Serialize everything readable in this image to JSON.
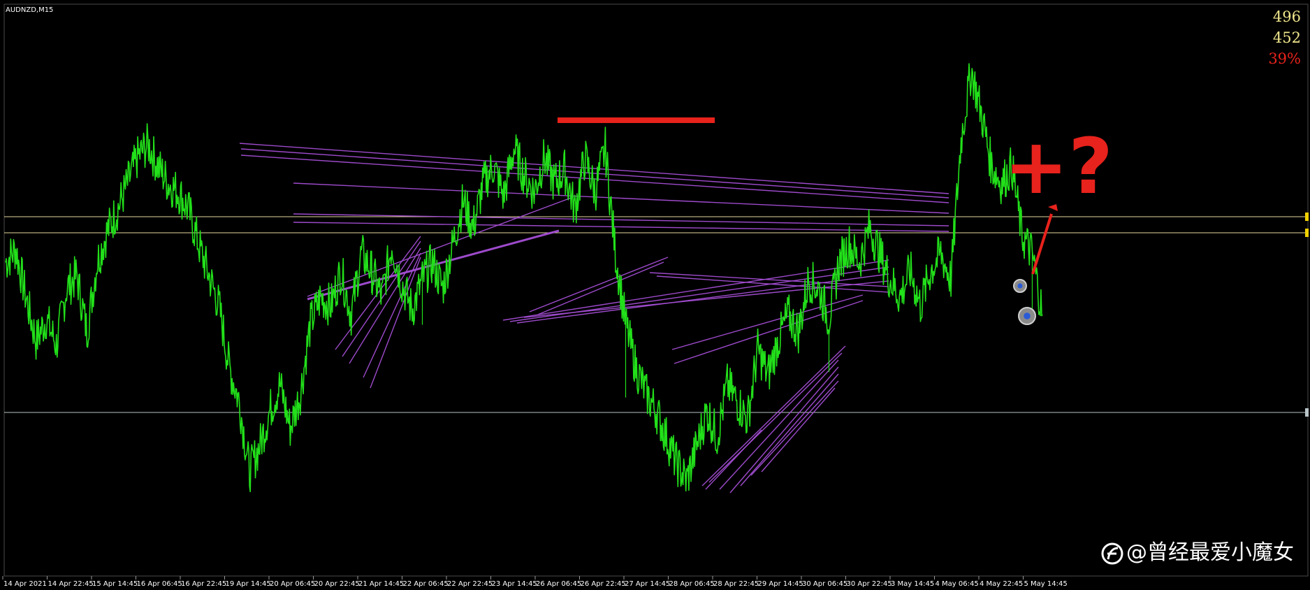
{
  "chart_data": {
    "type": "line",
    "symbol": "AUDNZD,M15",
    "x_ticks": [
      "14 Apr 2021",
      "14 Apr 22:45",
      "15 Apr 14:45",
      "16 Apr 06:45",
      "16 Apr 22:45",
      "19 Apr 14:45",
      "20 Apr 06:45",
      "20 Apr 22:45",
      "21 Apr 14:45",
      "22 Apr 06:45",
      "22 Apr 22:45",
      "23 Apr 14:45",
      "26 Apr 06:45",
      "26 Apr 22:45",
      "27 Apr 14:45",
      "28 Apr 06:45",
      "28 Apr 22:45",
      "29 Apr 14:45",
      "30 Apr 06:45",
      "30 Apr 22:45",
      "3 May 14:45",
      "4 May 06:45",
      "4 May 22:45",
      "5 May 14:45"
    ],
    "stats": [
      {
        "value": "496",
        "color": "#f0e68c"
      },
      {
        "value": "452",
        "color": "#f0e68c"
      },
      {
        "value": "39%",
        "color": "#e8221c"
      }
    ],
    "price_path": [
      [
        0,
        68
      ],
      [
        1,
        71
      ],
      [
        2,
        60
      ],
      [
        3,
        50
      ],
      [
        4,
        55
      ],
      [
        5,
        49
      ],
      [
        6,
        62
      ],
      [
        7,
        65
      ],
      [
        8,
        52
      ],
      [
        9,
        68
      ],
      [
        10,
        75
      ],
      [
        11,
        80
      ],
      [
        12,
        86
      ],
      [
        13,
        92
      ],
      [
        14,
        95
      ],
      [
        15,
        90
      ],
      [
        16,
        86
      ],
      [
        17,
        84
      ],
      [
        18,
        80
      ],
      [
        19,
        72
      ],
      [
        20,
        65
      ],
      [
        21,
        58
      ],
      [
        22,
        44
      ],
      [
        23,
        36
      ],
      [
        24,
        20
      ],
      [
        25,
        26
      ],
      [
        26,
        34
      ],
      [
        27,
        40
      ],
      [
        28,
        30
      ],
      [
        29,
        38
      ],
      [
        30,
        54
      ],
      [
        31,
        60
      ],
      [
        32,
        58
      ],
      [
        33,
        66
      ],
      [
        34,
        56
      ],
      [
        35,
        70
      ],
      [
        36,
        66
      ],
      [
        37,
        60
      ],
      [
        38,
        72
      ],
      [
        39,
        63
      ],
      [
        40,
        57
      ],
      [
        41,
        64
      ],
      [
        42,
        68
      ],
      [
        43,
        62
      ],
      [
        44,
        72
      ],
      [
        45,
        82
      ],
      [
        46,
        76
      ],
      [
        47,
        86
      ],
      [
        48,
        90
      ],
      [
        49,
        83
      ],
      [
        50,
        94
      ],
      [
        51,
        88
      ],
      [
        52,
        84
      ],
      [
        53,
        92
      ],
      [
        54,
        86
      ],
      [
        55,
        89
      ],
      [
        56,
        80
      ],
      [
        57,
        92
      ],
      [
        58,
        84
      ],
      [
        59,
        94
      ],
      [
        60,
        70
      ],
      [
        61,
        54
      ],
      [
        62,
        44
      ],
      [
        63,
        38
      ],
      [
        64,
        34
      ],
      [
        65,
        28
      ],
      [
        66,
        22
      ],
      [
        67,
        18
      ],
      [
        68,
        26
      ],
      [
        69,
        34
      ],
      [
        70,
        28
      ],
      [
        71,
        40
      ],
      [
        72,
        36
      ],
      [
        73,
        32
      ],
      [
        74,
        48
      ],
      [
        75,
        42
      ],
      [
        76,
        50
      ],
      [
        77,
        56
      ],
      [
        78,
        52
      ],
      [
        79,
        64
      ],
      [
        80,
        62
      ],
      [
        81,
        55
      ],
      [
        82,
        68
      ],
      [
        83,
        72
      ],
      [
        84,
        68
      ],
      [
        85,
        76
      ],
      [
        86,
        70
      ],
      [
        87,
        64
      ],
      [
        88,
        60
      ],
      [
        89,
        66
      ],
      [
        90,
        58
      ],
      [
        91,
        66
      ],
      [
        92,
        70
      ],
      [
        93,
        64
      ],
      [
        94,
        96
      ],
      [
        95,
        112
      ],
      [
        96,
        102
      ],
      [
        97,
        90
      ],
      [
        98,
        86
      ],
      [
        99,
        90
      ],
      [
        100,
        74
      ],
      [
        101,
        70
      ],
      [
        102,
        56
      ]
    ],
    "horizontal_levels": [
      {
        "name": "upper",
        "color": "#e6d9a0"
      },
      {
        "name": "middle",
        "color": "#e6d9a0"
      },
      {
        "name": "lower",
        "color": "#b8c4c8"
      }
    ],
    "trendline_color": "#a64fd6",
    "annotation": {
      "text": "+?",
      "color": "#e8221c"
    }
  },
  "watermark": {
    "text": "@曾经最爱小魔女"
  }
}
